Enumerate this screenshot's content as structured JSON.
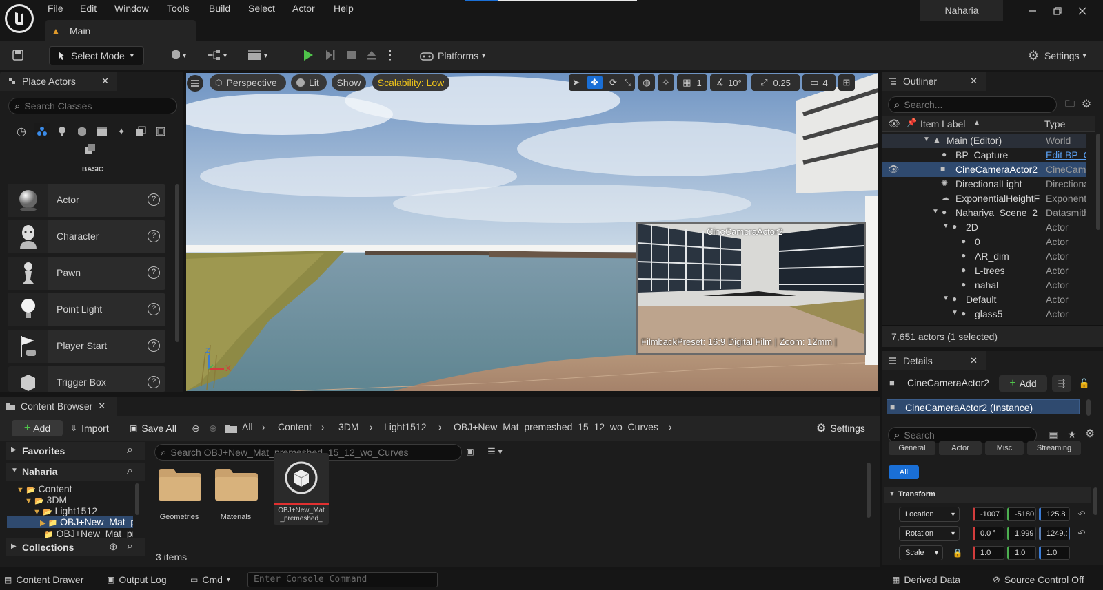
{
  "menu": {
    "file": "File",
    "edit": "Edit",
    "window": "Window",
    "tools": "Tools",
    "build": "Build",
    "select": "Select",
    "actor": "Actor",
    "help": "Help"
  },
  "project_name": "Naharia",
  "level_tab": "Main",
  "toolbar": {
    "select_mode": "Select Mode",
    "platforms": "Platforms",
    "settings": "Settings"
  },
  "place_actors": {
    "title": "Place Actors",
    "search_placeholder": "Search Classes",
    "category": "BASIC",
    "items": [
      "Actor",
      "Character",
      "Pawn",
      "Point Light",
      "Player Start",
      "Trigger Box"
    ]
  },
  "viewport": {
    "perspective": "Perspective",
    "lit": "Lit",
    "show": "Show",
    "scalability": "Scalability: Low",
    "grid": "1",
    "angle": "10°",
    "scale": "0.25",
    "camera_speed": "4",
    "pip_title": "CineCameraActor2",
    "pip_footer": "FilmbackPreset: 16:9 Digital Film | Zoom: 12mm |",
    "axis_z": "Z",
    "axis_x": "X"
  },
  "outliner": {
    "title": "Outliner",
    "search_placeholder": "Search...",
    "col_label": "Item Label",
    "col_type": "Type",
    "rows": [
      {
        "label": "Main (Editor)",
        "type": "World"
      },
      {
        "label": "BP_Capture",
        "type": "Edit BP_C"
      },
      {
        "label": "CineCameraActor2",
        "type": "CineCame"
      },
      {
        "label": "DirectionalLight",
        "type": "Directiona"
      },
      {
        "label": "ExponentialHeightF",
        "type": "Exponenti"
      },
      {
        "label": "Nahariya_Scene_2_",
        "type": "Datasmith"
      },
      {
        "label": "2D",
        "type": "Actor"
      },
      {
        "label": "0",
        "type": "Actor"
      },
      {
        "label": "AR_dim",
        "type": "Actor"
      },
      {
        "label": "L-trees",
        "type": "Actor"
      },
      {
        "label": "nahal",
        "type": "Actor"
      },
      {
        "label": "Default",
        "type": "Actor"
      },
      {
        "label": "glass5",
        "type": "Actor"
      }
    ],
    "count": "7,651 actors (1 selected)"
  },
  "details": {
    "title": "Details",
    "actor_name": "CineCameraActor2",
    "add": "Add",
    "instance": "CineCameraActor2 (Instance)",
    "search_placeholder": "Search",
    "tabs": [
      "General",
      "Actor",
      "Misc",
      "Streaming"
    ],
    "all": "All",
    "section": "Transform",
    "location": {
      "label": "Location",
      "x": "-1007",
      "y": "-5180",
      "z": "125.8"
    },
    "rotation": {
      "label": "Rotation",
      "x": "0.0 °",
      "y": "1.999",
      "z": "1249.:"
    },
    "scale": {
      "label": "Scale",
      "x": "1.0",
      "y": "1.0",
      "z": "1.0"
    }
  },
  "content_browser": {
    "title": "Content Browser",
    "add": "Add",
    "import": "Import",
    "save_all": "Save All",
    "crumbs": [
      "All",
      "Content",
      "3DM",
      "Light1512",
      "OBJ+New_Mat_premeshed_15_12_wo_Curves"
    ],
    "settings": "Settings",
    "favorites": "Favorites",
    "project": "Naharia",
    "collections": "Collections",
    "tree": [
      "Content",
      "3DM",
      "Light1512",
      "OBJ+New_Mat_p",
      "OBJ+New_Mat_pr"
    ],
    "search_placeholder": "Search OBJ+New_Mat_premeshed_15_12_wo_Curves",
    "assets": [
      {
        "name": "Geometries"
      },
      {
        "name": "Materials"
      },
      {
        "name": "OBJ+New_Mat _premeshed_"
      }
    ],
    "count": "3 items"
  },
  "statusbar": {
    "content_drawer": "Content Drawer",
    "output_log": "Output Log",
    "cmd": "Cmd",
    "console_placeholder": "Enter Console Command",
    "derived_data": "Derived Data",
    "source_control": "Source Control Off"
  },
  "colors": {
    "accent": "#1a6fd6",
    "play": "#4fc34a",
    "scalability": "#f0c419",
    "selection": "#2f4a6f"
  }
}
